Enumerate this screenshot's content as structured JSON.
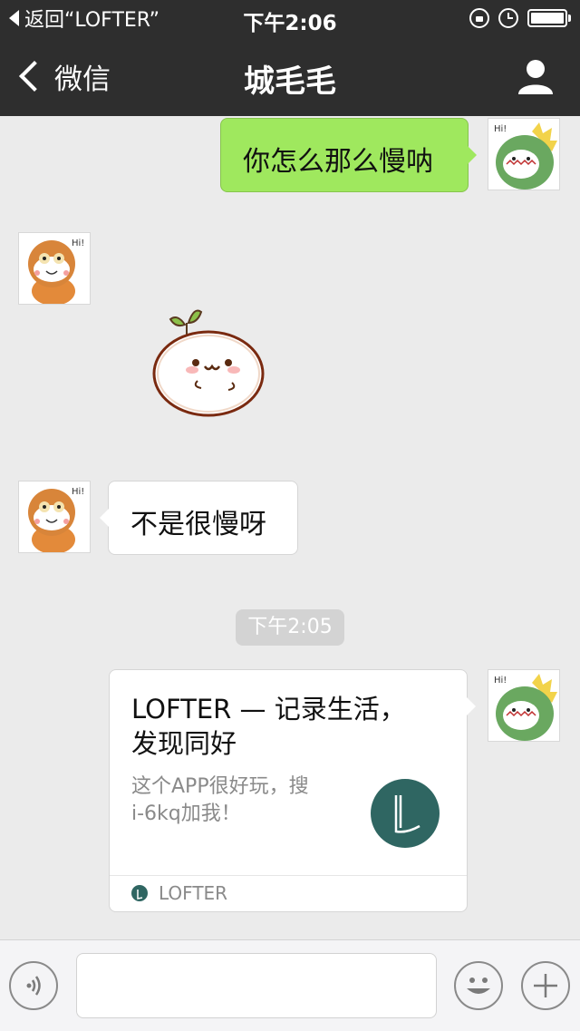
{
  "status_bar": {
    "back_label": "返回“LOFTER”",
    "time": "下午2:06"
  },
  "nav": {
    "back_label": "微信",
    "title": "城毛毛"
  },
  "messages": [
    {
      "side": "right",
      "type": "text",
      "text": "你怎么那么慢呐"
    },
    {
      "side": "left",
      "type": "sticker",
      "sticker": "sprout-bun-sticker"
    },
    {
      "side": "left",
      "type": "text",
      "text": "不是很慢呀"
    }
  ],
  "timestamp": "下午2:05",
  "link_card": {
    "title": "LOFTER — 记录生活，\n发现同好",
    "description": "这个APP很好玩，搜\ni-6kq加我！",
    "source_name": "LOFTER"
  },
  "colors": {
    "bar_background": "#2e2e2e",
    "chat_background": "#ebebeb",
    "sent_bubble": "#9fe85e",
    "received_bubble": "#ffffff",
    "lofter_brand": "#2f6662"
  },
  "icons": {
    "profile": "person-icon",
    "voice": "voice-icon",
    "emoji": "emoji-icon",
    "more": "plus-icon"
  }
}
